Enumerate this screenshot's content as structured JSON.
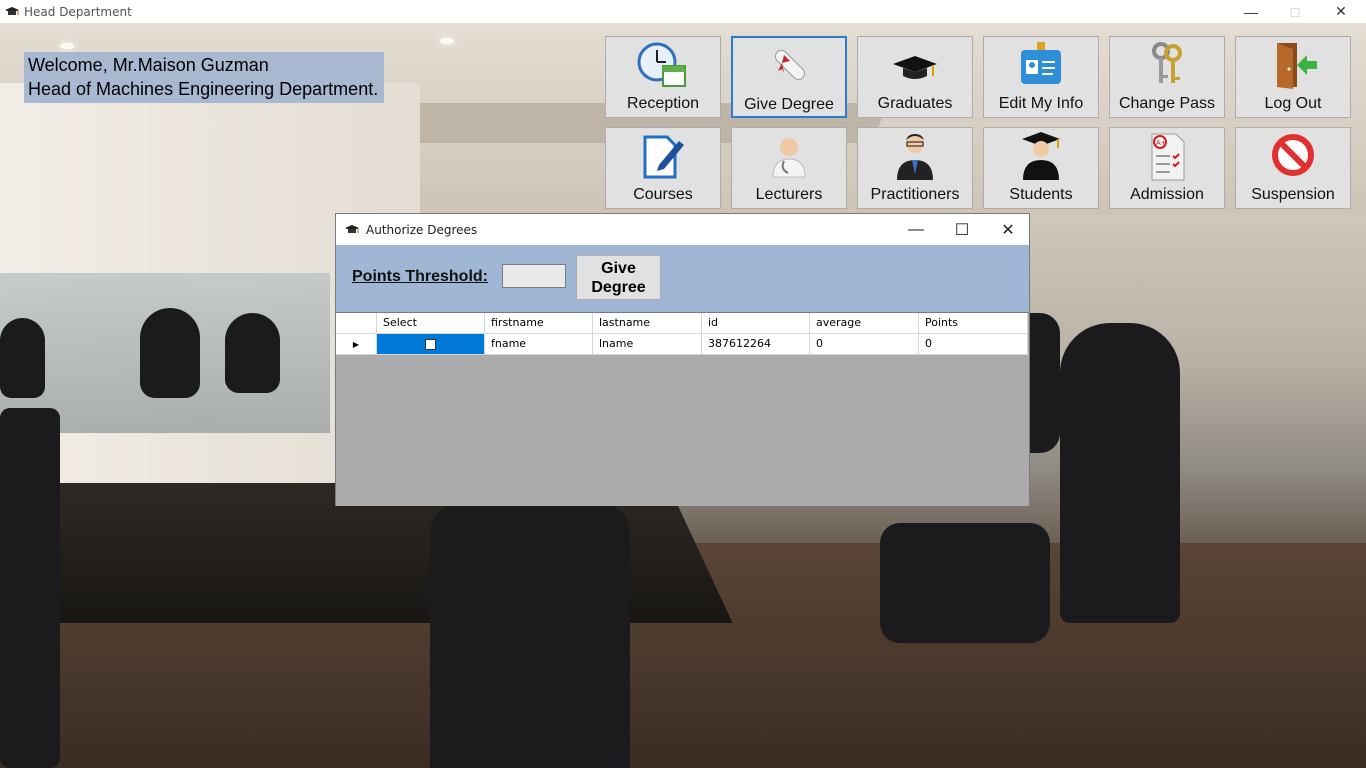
{
  "window": {
    "title": "Head Department",
    "controls": [
      "minimize-icon",
      "maximize-icon",
      "close-icon"
    ]
  },
  "welcome": {
    "line1": "Welcome, Mr.Maison Guzman",
    "line2": "Head of Machines Engineering Department."
  },
  "tiles": [
    {
      "label": "Reception",
      "icon": "calendar-clock-icon"
    },
    {
      "label": "Give Degree",
      "icon": "diploma-icon"
    },
    {
      "label": "Graduates",
      "icon": "graduation-cap-icon"
    },
    {
      "label": "Edit My Info",
      "icon": "id-badge-icon"
    },
    {
      "label": "Change Pass",
      "icon": "keys-icon"
    },
    {
      "label": "Log Out",
      "icon": "door-exit-icon"
    },
    {
      "label": "Courses",
      "icon": "document-pen-icon"
    },
    {
      "label": "Lecturers",
      "icon": "doctor-icon"
    },
    {
      "label": "Practitioners",
      "icon": "professional-icon"
    },
    {
      "label": "Students",
      "icon": "student-icon"
    },
    {
      "label": "Admission",
      "icon": "graded-checklist-icon"
    },
    {
      "label": "Suspension",
      "icon": "prohibited-icon"
    }
  ],
  "dialog": {
    "title": "Authorize Degrees",
    "threshold_label": "Points Threshold:",
    "threshold_value": "",
    "give_button": "Give Degree",
    "columns": [
      "Select",
      "firstname",
      "lastname",
      "id",
      "average",
      "Points"
    ],
    "rows": [
      {
        "selected": false,
        "firstname": "fname",
        "lastname": "lname",
        "id": "387612264",
        "average": "0",
        "points": "0"
      }
    ]
  },
  "colors": {
    "accent": "#2a7bd1",
    "selection": "#0078d7",
    "dialog_body": "#9fb6d4",
    "welcome_bg": "#a8b8d0"
  }
}
